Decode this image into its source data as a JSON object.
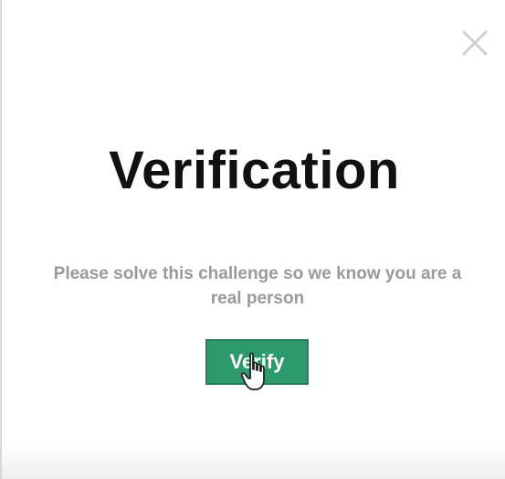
{
  "dialog": {
    "title": "Verification",
    "message": "Please solve this challenge so we know you are a real person",
    "verify_button_label": "Verify",
    "close_icon": "close-icon",
    "cursor_icon": "hand-pointer-icon"
  },
  "colors": {
    "accent": "#2e9a6b",
    "title_text": "#111111",
    "message_text": "#9a9a9a",
    "close_icon": "#cfcfcf"
  }
}
